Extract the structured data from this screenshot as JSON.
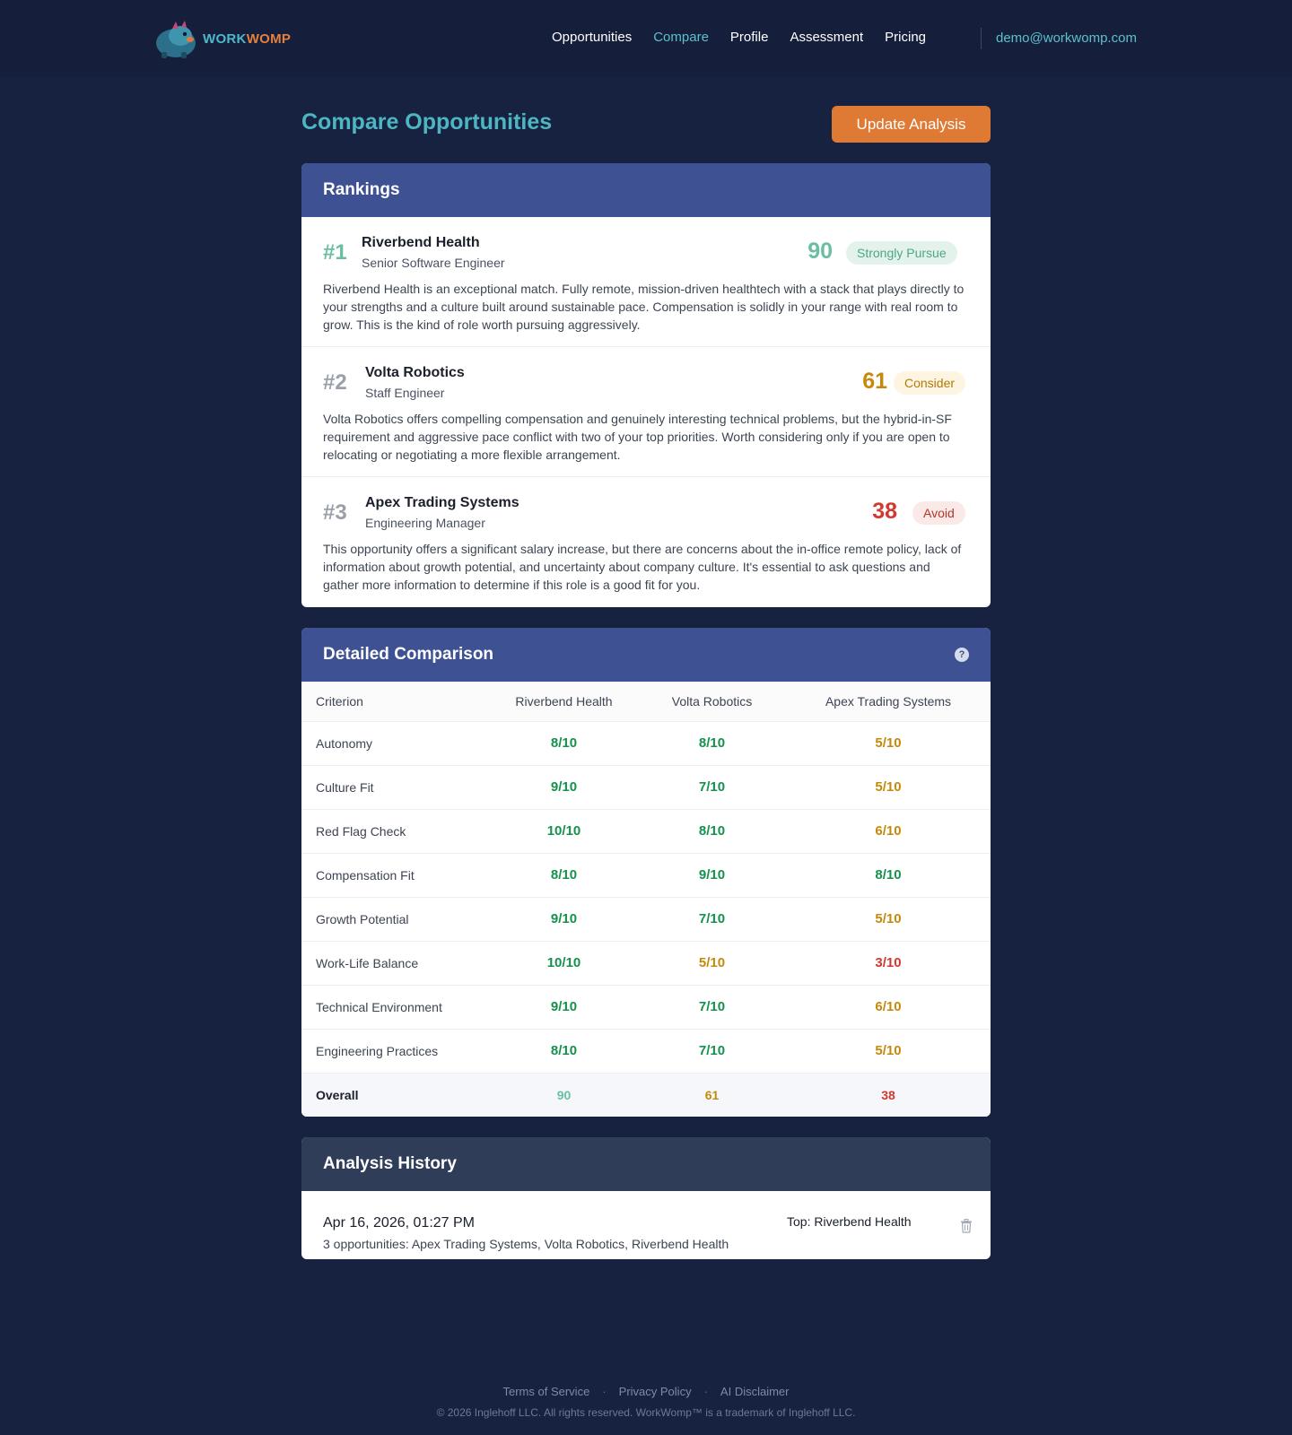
{
  "header": {
    "logo_part1": "WORK",
    "logo_part2": "WOMP",
    "nav": [
      {
        "label": "Opportunities",
        "active": false
      },
      {
        "label": "Compare",
        "active": true
      },
      {
        "label": "Profile",
        "active": false
      },
      {
        "label": "Assessment",
        "active": false
      },
      {
        "label": "Pricing",
        "active": false
      }
    ],
    "user_email": "demo@workwomp.com"
  },
  "page": {
    "title": "Compare Opportunities",
    "update_button": "Update Analysis"
  },
  "rankings": {
    "title": "Rankings",
    "items": [
      {
        "rank": "#1",
        "company": "Riverbend Health",
        "role": "Senior Software Engineer",
        "score": "90",
        "verdict": "Strongly Pursue",
        "summary": "Riverbend Health is an exceptional match. Fully remote, mission-driven healthtech with a stack that plays directly to your strengths and a culture built around sustainable pace. Compensation is solidly in your range with real room to grow. This is the kind of role worth pursuing aggressively."
      },
      {
        "rank": "#2",
        "company": "Volta Robotics",
        "role": "Staff Engineer",
        "score": "61",
        "verdict": "Consider",
        "summary": "Volta Robotics offers compelling compensation and genuinely interesting technical problems, but the hybrid-in-SF requirement and aggressive pace conflict with two of your top priorities. Worth considering only if you are open to relocating or negotiating a more flexible arrangement."
      },
      {
        "rank": "#3",
        "company": "Apex Trading Systems",
        "role": "Engineering Manager",
        "score": "38",
        "verdict": "Avoid",
        "summary": "This opportunity offers a significant salary increase, but there are concerns about the in-office remote policy, lack of information about growth potential, and uncertainty about company culture. It's essential to ask questions and gather more information to determine if this role is a good fit for you."
      }
    ]
  },
  "comparison": {
    "title": "Detailed Comparison",
    "headers": [
      "Criterion",
      "Riverbend Health",
      "Volta Robotics",
      "Apex Trading Systems"
    ],
    "rows": [
      {
        "criterion": "Autonomy",
        "scores": [
          "8/10",
          "8/10",
          "5/10"
        ]
      },
      {
        "criterion": "Culture Fit",
        "scores": [
          "9/10",
          "7/10",
          "5/10"
        ]
      },
      {
        "criterion": "Red Flag Check",
        "scores": [
          "10/10",
          "8/10",
          "6/10"
        ]
      },
      {
        "criterion": "Compensation Fit",
        "scores": [
          "8/10",
          "9/10",
          "8/10"
        ]
      },
      {
        "criterion": "Growth Potential",
        "scores": [
          "9/10",
          "7/10",
          "5/10"
        ]
      },
      {
        "criterion": "Work-Life Balance",
        "scores": [
          "10/10",
          "5/10",
          "3/10"
        ]
      },
      {
        "criterion": "Technical Environment",
        "scores": [
          "9/10",
          "7/10",
          "6/10"
        ]
      },
      {
        "criterion": "Engineering Practices",
        "scores": [
          "8/10",
          "7/10",
          "5/10"
        ]
      }
    ],
    "overall_label": "Overall",
    "overall": [
      "90",
      "61",
      "38"
    ]
  },
  "history": {
    "title": "Analysis History",
    "entries": [
      {
        "date": "Apr 16, 2026, 01:27 PM",
        "opportunities": "3 opportunities: Apex Trading Systems, Volta Robotics, Riverbend Health",
        "top": "Top: Riverbend Health"
      }
    ]
  },
  "footer": {
    "links": [
      "Terms of Service",
      "Privacy Policy",
      "AI Disclaimer"
    ],
    "copyright": "© 2026 Inglehoff LLC. All rights reserved. WorkWomp™ is a trademark of Inglehoff LLC."
  },
  "colors": {
    "background": "#172240",
    "accent_teal": "#4eb5c3",
    "accent_orange": "#df7a35",
    "card_header": "#3e5193",
    "strong": "#15914d",
    "medium": "#c58a0b",
    "weak": "#d1392f"
  }
}
